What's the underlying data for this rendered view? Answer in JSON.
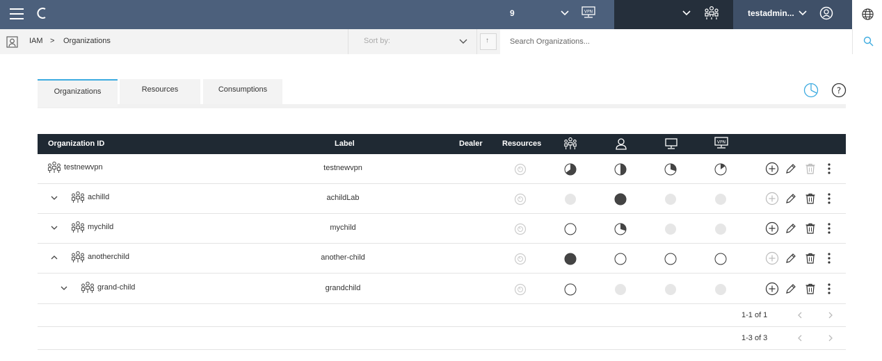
{
  "topbar": {
    "counter": "9",
    "username": "testadmin...",
    "vpn_icon_label": "VPN"
  },
  "breadcrumb": {
    "root": "IAM",
    "separator": ">",
    "current": "Organizations"
  },
  "sort": {
    "label": "Sort by:",
    "direction_symbol": "↑"
  },
  "search": {
    "placeholder": "Search Organizations..."
  },
  "tabs": [
    {
      "label": "Organizations",
      "active": true
    },
    {
      "label": "Resources",
      "active": false
    },
    {
      "label": "Consumptions",
      "active": false
    }
  ],
  "table": {
    "headers": {
      "org_id": "Organization ID",
      "label": "Label",
      "dealer": "Dealer",
      "resources": "Resources",
      "vpn_label": "VPN"
    },
    "rows": [
      {
        "id": "testnewvpn",
        "label": "testnewvpn",
        "level": 0,
        "expander": "none",
        "orgs": 0.65,
        "users": 0.5,
        "desktops": 0.3,
        "vpns": 0.15,
        "add_enabled": true,
        "delete_enabled": false
      },
      {
        "id": "achilld",
        "label": "achildLab",
        "level": 1,
        "expander": "down",
        "orgs": "empty",
        "users": 1.0,
        "desktops": "empty",
        "vpns": "empty",
        "add_enabled": false,
        "delete_enabled": true
      },
      {
        "id": "mychild",
        "label": "mychild",
        "level": 1,
        "expander": "down",
        "orgs": 0,
        "users": 0.3,
        "desktops": "empty",
        "vpns": "empty",
        "add_enabled": true,
        "delete_enabled": true
      },
      {
        "id": "anotherchild",
        "label": "another-child",
        "level": 1,
        "expander": "up",
        "orgs": 1.0,
        "users": 0,
        "desktops": 0,
        "vpns": 0,
        "add_enabled": false,
        "delete_enabled": true
      },
      {
        "id": "grand-child",
        "label": "grandchild",
        "level": 2,
        "expander": "down",
        "orgs": 0,
        "users": "empty",
        "desktops": "empty",
        "vpns": "empty",
        "add_enabled": true,
        "delete_enabled": true
      }
    ]
  },
  "pagers": [
    {
      "info": "1-1 of 1"
    },
    {
      "info": "1-3 of 3"
    }
  ],
  "colors": {
    "topbar": "#4c607c",
    "table_header": "#1f2933",
    "accent": "#3dabe0",
    "indicator_fill": "#444444",
    "indicator_empty": "#e6e6e6"
  }
}
